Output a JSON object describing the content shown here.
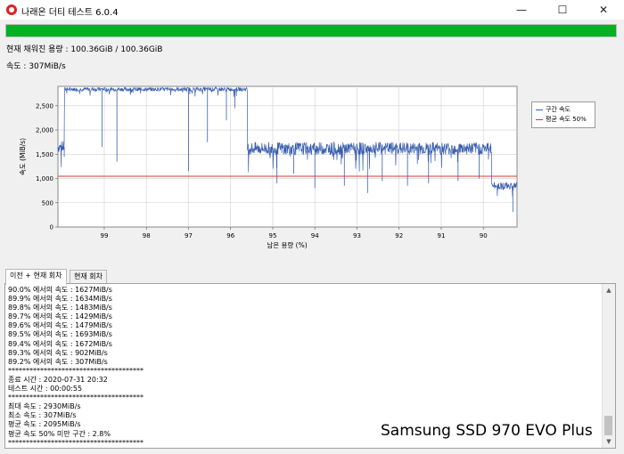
{
  "window": {
    "title": "나래온 더티 테스트 6.0.4",
    "controls": {
      "minimize": "—",
      "maximize": "☐",
      "close": "✕"
    }
  },
  "progress": {
    "fraction": 1.0,
    "color": "#06b025"
  },
  "status": {
    "written": "현재 채워진 용량 : 100.36GiB / 100.36GiB",
    "speed": "속도 : 307MiB/s"
  },
  "chart_data": {
    "type": "line",
    "xlabel": "남은 용량 (%)",
    "ylabel": "속도 (MiB/s)",
    "x_reversed": true,
    "xlim": [
      100.1,
      89.2
    ],
    "ylim": [
      0,
      2900
    ],
    "x_ticks": [
      "99",
      "98",
      "97",
      "96",
      "95",
      "94",
      "93",
      "92",
      "91",
      "90"
    ],
    "x_tick_values": [
      99,
      98,
      97,
      96,
      95,
      94,
      93,
      92,
      91,
      90
    ],
    "y_ticks": [
      "0",
      "500",
      "1,000",
      "1,500",
      "2,000",
      "2,500"
    ],
    "y_tick_values": [
      0,
      500,
      1000,
      1500,
      2000,
      2500
    ],
    "grid": true,
    "legend_position": "right",
    "series": [
      {
        "name": "구간 속도",
        "color": "#3a5fb0",
        "segments": [
          {
            "from": 100.1,
            "to": 99.95,
            "level": 1650,
            "noise": 120
          },
          {
            "from": 99.95,
            "to": 95.6,
            "level": 2840,
            "noise": 40
          },
          {
            "from": 95.6,
            "to": 89.8,
            "level": 1620,
            "noise": 130
          },
          {
            "from": 89.8,
            "to": 89.2,
            "level": 850,
            "noise": 80
          }
        ],
        "dips": [
          {
            "x": 99.95,
            "y": 1450
          },
          {
            "x": 99.05,
            "y": 1650
          },
          {
            "x": 98.7,
            "y": 1350
          },
          {
            "x": 97.0,
            "y": 1150
          },
          {
            "x": 96.55,
            "y": 1750
          },
          {
            "x": 96.1,
            "y": 2200
          },
          {
            "x": 95.9,
            "y": 2450
          },
          {
            "x": 94.9,
            "y": 900
          },
          {
            "x": 94.5,
            "y": 1100
          },
          {
            "x": 94.0,
            "y": 800
          },
          {
            "x": 93.3,
            "y": 850
          },
          {
            "x": 92.75,
            "y": 700
          },
          {
            "x": 92.4,
            "y": 950
          },
          {
            "x": 91.8,
            "y": 850
          },
          {
            "x": 91.3,
            "y": 900
          },
          {
            "x": 90.6,
            "y": 950
          },
          {
            "x": 90.1,
            "y": 1000
          },
          {
            "x": 89.3,
            "y": 307
          }
        ]
      },
      {
        "name": "평균 속도 50%",
        "color": "#e03030",
        "values": [
          {
            "x": 100.1,
            "y": 1047
          },
          {
            "x": 89.2,
            "y": 1047
          }
        ]
      }
    ]
  },
  "tabs": [
    "이전 + 현재 회차",
    "현재 회차"
  ],
  "log": [
    "90.0% 에서의 속도 : 1627MiB/s",
    "89.9% 에서의 속도 : 1634MiB/s",
    "89.8% 에서의 속도 : 1483MiB/s",
    "89.7% 에서의 속도 : 1429MiB/s",
    "89.6% 에서의 속도 : 1479MiB/s",
    "89.5% 에서의 속도 : 1693MiB/s",
    "89.4% 에서의 속도 : 1672MiB/s",
    "89.3% 에서의 속도 : 902MiB/s",
    "89.2% 에서의 속도 : 307MiB/s",
    "**************************************",
    "종료 시간 : 2020-07-31 20:32",
    "테스트 시간 : 00:00:55",
    "**************************************",
    "최대 속도 : 2930MiB/s",
    "최소 속도 : 307MiB/s",
    "평균 속도 : 2095MiB/s",
    "평균 속도 50% 미만 구간 : 2.8%",
    "**************************************"
  ],
  "scroll": {
    "up": "▲",
    "down": "▼"
  },
  "overlay_text": "Samsung SSD 970 EVO Plus"
}
